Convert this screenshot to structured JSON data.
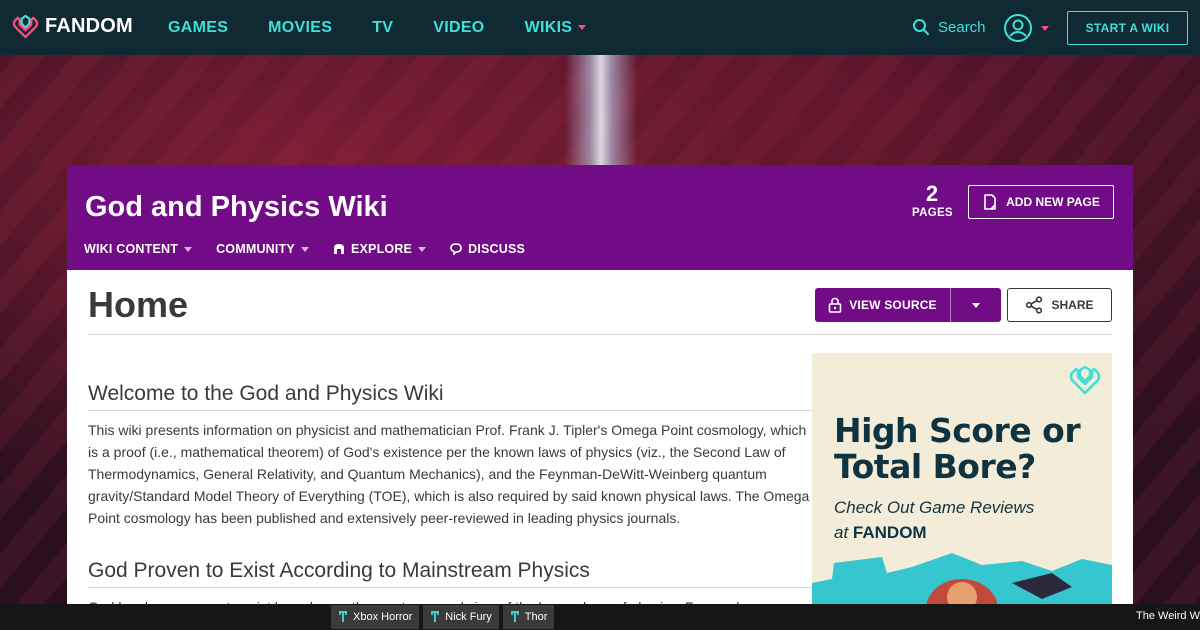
{
  "global_nav": {
    "brand": "FANDOM",
    "links": [
      {
        "label": "GAMES"
      },
      {
        "label": "MOVIES"
      },
      {
        "label": "TV"
      },
      {
        "label": "VIDEO"
      },
      {
        "label": "WIKIS"
      }
    ],
    "search_label": "Search",
    "start_wiki_label": "START A WIKI"
  },
  "wiki": {
    "title": "God and Physics Wiki",
    "nav": [
      {
        "label": "WIKI CONTENT"
      },
      {
        "label": "COMMUNITY"
      },
      {
        "label": "EXPLORE"
      },
      {
        "label": "DISCUSS"
      }
    ],
    "page_count": "2",
    "page_count_label": "PAGES",
    "add_page_label": "ADD NEW PAGE"
  },
  "page": {
    "title": "Home",
    "view_source_label": "VIEW SOURCE",
    "share_label": "SHARE",
    "sections": [
      {
        "heading": "Welcome to the God and Physics Wiki",
        "body": "This wiki presents information on physicist and mathematician Prof. Frank J. Tipler's Omega Point cosmology, which is a proof (i.e., mathematical theorem) of God's existence per the known laws of physics (viz., the Second Law of Thermodynamics, General Relativity, and Quantum Mechanics), and the Feynman-DeWitt-Weinberg quantum gravity/Standard Model Theory of Everything (TOE), which is also required by said known physical laws. The Omega Point cosmology has been published and extensively peer-reviewed in leading physics journals."
      },
      {
        "heading": "God Proven to Exist According to Mainstream Physics",
        "body": "God has been proven to exist based upon the most reserved view of the known laws of physics. For much more on"
      }
    ]
  },
  "ad": {
    "headline_line1": "High Score or",
    "headline_line2": "Total Bore?",
    "sub_line1": "Check Out Game Reviews",
    "sub_at": "at",
    "sub_brand": "FANDOM"
  },
  "bottom_bar": {
    "items": [
      {
        "label": "Xbox Horror"
      },
      {
        "label": "Nick Fury"
      },
      {
        "label": "Thor"
      }
    ],
    "right_text": "The Weird W"
  },
  "colors": {
    "nav_bg": "#0f2a33",
    "nav_accent": "#3ee0d8",
    "wiki_purple": "#720b86",
    "caret_pink": "#ff4a80"
  },
  "icons": [
    "fandom-logo-icon",
    "search-icon",
    "user-avatar-icon",
    "page-icon",
    "lock-icon",
    "share-icon",
    "explore-icon",
    "discuss-icon",
    "pin-icon"
  ]
}
